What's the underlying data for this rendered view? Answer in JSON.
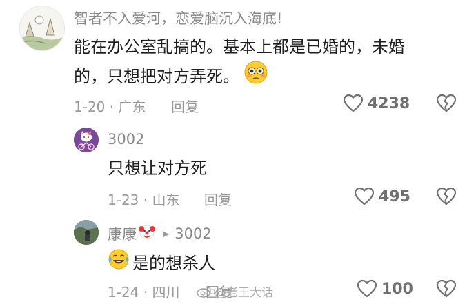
{
  "comments": [
    {
      "username": "智者不入爱河，恋爱脑沉入海底!",
      "content_line1": "能在办公室乱搞的。基本上都是已婚的，未婚",
      "content_line2": "的，只想把对方弄死。",
      "meta": "1-20 · 广东",
      "reply_label": "回复",
      "likes": "4238",
      "avatar_icon": "landscape-sketch-avatar",
      "emoji_icon": "flushed-face-emoji"
    },
    {
      "username": "3002",
      "content": "只想让对方死",
      "meta": "1-23 · 山东",
      "reply_label": "回复",
      "likes": "495",
      "avatar_icon": "hello-kitty-bike-avatar"
    },
    {
      "username": "康康",
      "reply_to": "3002",
      "content": "是的想杀人",
      "meta": "1-24 · 四川",
      "reply_label": "回复",
      "likes": "100",
      "avatar_icon": "photo-avatar",
      "name_emoji_icon": "clown-face-emoji",
      "content_emoji_icon": "crying-laughing-emoji"
    }
  ],
  "watermark": {
    "text": "@老王大话",
    "icon": "weibo-logo-icon"
  },
  "colors": {
    "text_primary": "#1e1e1e",
    "text_secondary": "#9a9a9a",
    "icon_gray": "#6f6f6f"
  }
}
